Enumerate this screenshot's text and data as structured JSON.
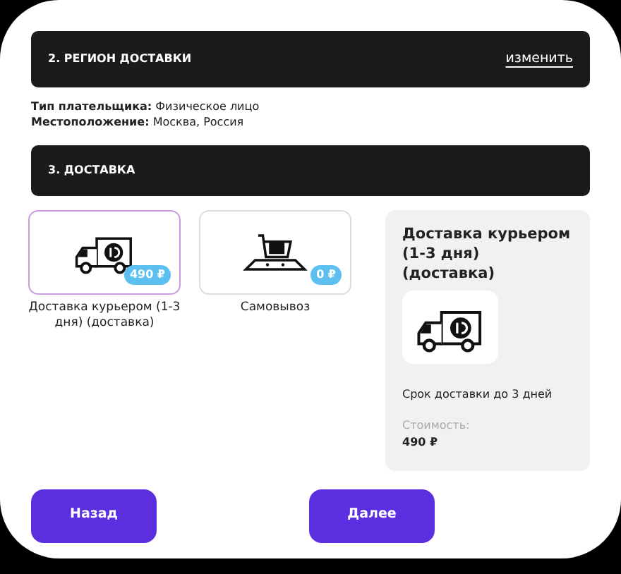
{
  "region_section": {
    "title": "2. РЕГИОН ДОСТАВКИ",
    "link": "изменить"
  },
  "info": [
    "**Тип плательщика:** Физическое лицо",
    "**Местоположение:** Москва, Россия"
  ],
  "delivery_section": {
    "title": "3. ДОСТАВКА"
  },
  "options": [
    {
      "kind": "truck",
      "label": "Доставка курьером (1-3 дня) (доставка)",
      "price": "490 ₽",
      "selected": true
    },
    {
      "kind": "cart",
      "label": "Самовывоз",
      "price": "0 ₽",
      "selected": false
    }
  ],
  "details": {
    "kind": "truck",
    "title": "Доставка курьером (1-3 дня) (доставка)",
    "term": "Срок доставки до 3 дней",
    "cost_label": "Стоимость:",
    "cost": "490 ₽"
  },
  "buttons": [
    "Назад",
    "Далее"
  ]
}
